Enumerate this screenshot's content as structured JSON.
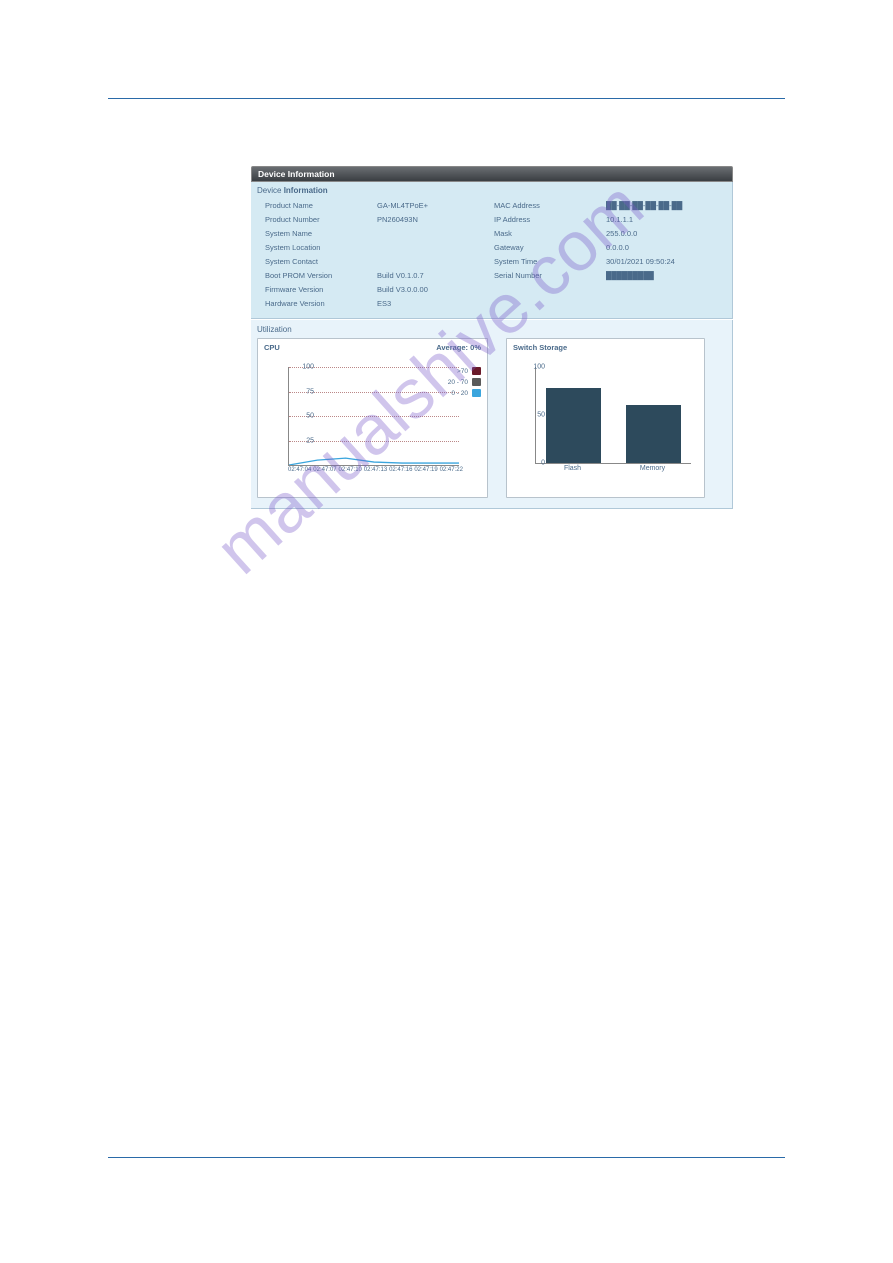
{
  "panel_title": "Device Information",
  "info_heading_normal": "Device",
  "info_heading_bold": "Information",
  "util_heading": "Utilization",
  "left_rows": [
    {
      "label": "Product Name",
      "value": "GA-ML4TPoE+"
    },
    {
      "label": "Product Number",
      "value": "PN260493N"
    },
    {
      "label": "System Name",
      "value": ""
    },
    {
      "label": "System Location",
      "value": ""
    },
    {
      "label": "System Contact",
      "value": ""
    },
    {
      "label": "Boot PROM Version",
      "value": "Build V0.1.0.7"
    },
    {
      "label": "Firmware Version",
      "value": "Build V3.0.0.00"
    },
    {
      "label": "Hardware Version",
      "value": "ES3"
    }
  ],
  "right_rows": [
    {
      "label": "MAC Address",
      "value": "██-██-██-██-██-██"
    },
    {
      "label": "IP Address",
      "value": "10.1.1.1"
    },
    {
      "label": "Mask",
      "value": "255.0.0.0"
    },
    {
      "label": "Gateway",
      "value": "0.0.0.0"
    },
    {
      "label": "System Time",
      "value": "30/01/2021 09:50:24"
    },
    {
      "label": "Serial Number",
      "value": "█████████"
    }
  ],
  "cpu_chart": {
    "title": "CPU",
    "average_label": "Average:",
    "average_value": "0%",
    "legend": [
      {
        "label": ">70",
        "color": "#6a1a2a"
      },
      {
        "label": "20 - 70",
        "color": "#5a5a5a"
      },
      {
        "label": "0 - 20",
        "color": "#3aa5dd"
      }
    ]
  },
  "storage_chart": {
    "title": "Switch Storage"
  },
  "watermark": "manualshive.com",
  "chart_data": [
    {
      "type": "line",
      "title": "CPU",
      "xlabel": "",
      "ylabel": "",
      "ylim": [
        0,
        100
      ],
      "yticks": [
        25,
        50,
        75,
        100
      ],
      "x": [
        "02:47:04",
        "02:47:07",
        "02:47:10",
        "02:47:13",
        "02:47:16",
        "02:47:19",
        "02:47:22"
      ],
      "series": [
        {
          "name": "0 - 20",
          "values": [
            0,
            5,
            7,
            3,
            2,
            2,
            2
          ]
        }
      ]
    },
    {
      "type": "bar",
      "title": "Switch Storage",
      "xlabel": "",
      "ylabel": "",
      "ylim": [
        0,
        100
      ],
      "yticks": [
        0,
        50,
        100
      ],
      "categories": [
        "Flash",
        "Memory"
      ],
      "values": [
        78,
        60
      ]
    }
  ]
}
